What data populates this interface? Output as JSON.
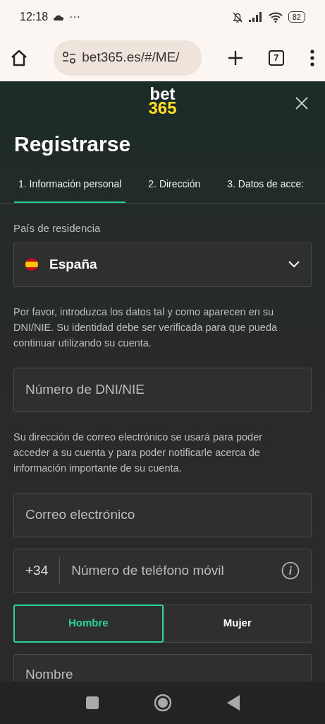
{
  "status_bar": {
    "time": "12:18",
    "more": "···",
    "battery": "82"
  },
  "browser": {
    "url": "bet365.es/#/ME/",
    "tab_count": "7"
  },
  "logo": {
    "line1": "bet",
    "line2": "365"
  },
  "title": "Registrarse",
  "tabs": [
    {
      "label": "1.  Información personal",
      "selected": true
    },
    {
      "label": "2.  Dirección",
      "selected": false
    },
    {
      "label": "3.  Datos de acce:",
      "selected": false
    }
  ],
  "country": {
    "label": "País de residencia",
    "value": "España"
  },
  "notes": [
    "Por favor, introduzca los datos tal y como aparecen en su DNI/NIE. Su identidad debe ser verificada para que pueda continuar utilizando su cuenta.",
    "Su dirección de correo electrónico se usará para poder acceder a su cuenta y para poder notificarle acerca de información importante de su cuenta."
  ],
  "dni": {
    "placeholder": "Número de DNI/NIE"
  },
  "email": {
    "placeholder": "Correo electrónico"
  },
  "phone": {
    "prefix": "+34",
    "placeholder": "Número de teléfono móvil"
  },
  "gender": [
    {
      "label": "Hombre",
      "selected": true
    },
    {
      "label": "Mujer",
      "selected": false
    }
  ],
  "name": {
    "placeholder": "Nombre"
  }
}
